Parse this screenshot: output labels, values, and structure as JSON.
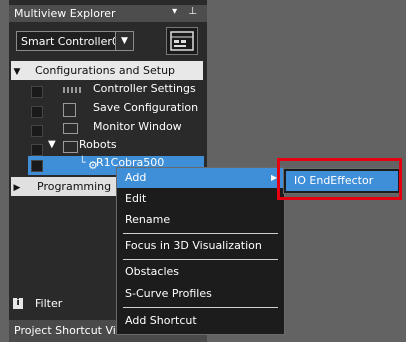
{
  "panel": {
    "title": "Multiview Explorer",
    "title_buttons": "▾ ⊥",
    "controller": "Smart Controller0",
    "filter_label": "Filter",
    "shortcut_label": "Project Shortcut Vie..."
  },
  "tree": {
    "configurations": "Configurations and Setup",
    "controller_settings": "Controller Settings",
    "save_configuration": "Save Configuration",
    "monitor_window": "Monitor Window",
    "robots": "Robots",
    "robot_item": "R1Cobra500",
    "programming": "Programming"
  },
  "context_menu": {
    "items": [
      "Add",
      "Edit",
      "Rename",
      "Focus in 3D Visualization",
      "Obstacles",
      "S-Curve Profiles",
      "Add Shortcut"
    ]
  },
  "submenu": {
    "item": "IO EndEffector"
  },
  "colors": {
    "highlight": "#3f8fd8",
    "callout": "#e60012"
  },
  "icons": [
    "pin-icon",
    "dropdown-arrow-icon",
    "controller-device-icon",
    "settings-icon",
    "save-icon",
    "monitor-icon",
    "folder-icon",
    "robot-icon",
    "filter-icon",
    "submenu-arrow-icon"
  ]
}
